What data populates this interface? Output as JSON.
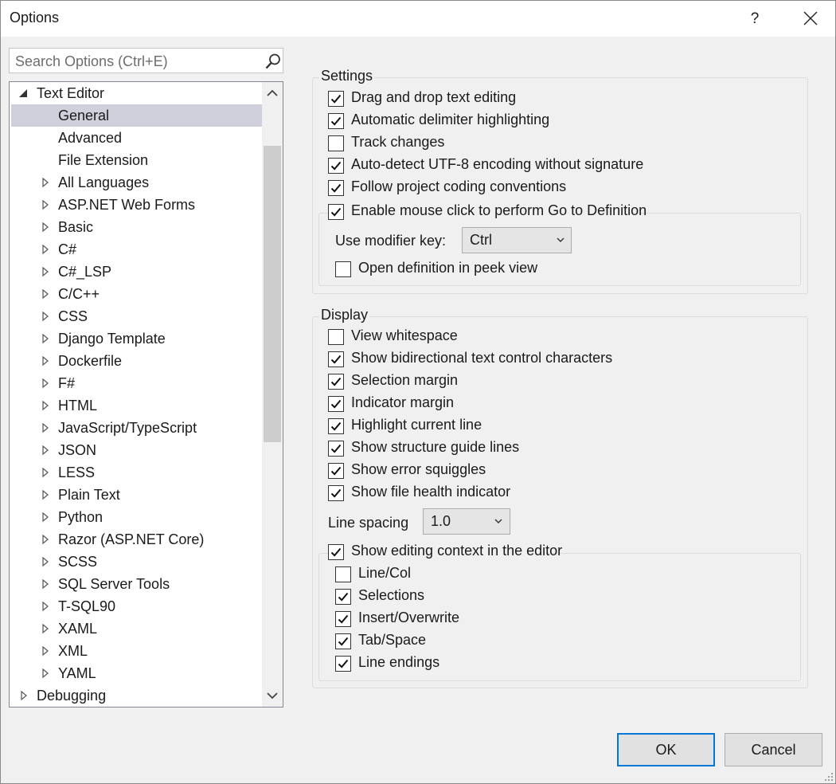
{
  "window": {
    "title": "Options",
    "help_label": "?"
  },
  "search": {
    "placeholder": "Search Options (Ctrl+E)"
  },
  "tree": [
    {
      "label": "Text Editor",
      "level": 0,
      "expanded": true
    },
    {
      "label": "General",
      "level": 1,
      "selected": true
    },
    {
      "label": "Advanced",
      "level": 1
    },
    {
      "label": "File Extension",
      "level": 1
    },
    {
      "label": "All Languages",
      "level": 1,
      "collapsed": true
    },
    {
      "label": "ASP.NET Web Forms",
      "level": 1,
      "collapsed": true
    },
    {
      "label": "Basic",
      "level": 1,
      "collapsed": true
    },
    {
      "label": "C#",
      "level": 1,
      "collapsed": true
    },
    {
      "label": "C#_LSP",
      "level": 1,
      "collapsed": true
    },
    {
      "label": "C/C++",
      "level": 1,
      "collapsed": true
    },
    {
      "label": "CSS",
      "level": 1,
      "collapsed": true
    },
    {
      "label": "Django Template",
      "level": 1,
      "collapsed": true
    },
    {
      "label": "Dockerfile",
      "level": 1,
      "collapsed": true
    },
    {
      "label": "F#",
      "level": 1,
      "collapsed": true
    },
    {
      "label": "HTML",
      "level": 1,
      "collapsed": true
    },
    {
      "label": "JavaScript/TypeScript",
      "level": 1,
      "collapsed": true
    },
    {
      "label": "JSON",
      "level": 1,
      "collapsed": true
    },
    {
      "label": "LESS",
      "level": 1,
      "collapsed": true
    },
    {
      "label": "Plain Text",
      "level": 1,
      "collapsed": true
    },
    {
      "label": "Python",
      "level": 1,
      "collapsed": true
    },
    {
      "label": "Razor (ASP.NET Core)",
      "level": 1,
      "collapsed": true
    },
    {
      "label": "SCSS",
      "level": 1,
      "collapsed": true
    },
    {
      "label": "SQL Server Tools",
      "level": 1,
      "collapsed": true
    },
    {
      "label": "T-SQL90",
      "level": 1,
      "collapsed": true
    },
    {
      "label": "XAML",
      "level": 1,
      "collapsed": true
    },
    {
      "label": "XML",
      "level": 1,
      "collapsed": true
    },
    {
      "label": "YAML",
      "level": 1,
      "collapsed": true
    },
    {
      "label": "Debugging",
      "level": 0,
      "collapsed": true
    }
  ],
  "settings": {
    "title": "Settings",
    "items": [
      {
        "label": "Drag and drop text editing",
        "checked": true
      },
      {
        "label": "Automatic delimiter highlighting",
        "checked": true
      },
      {
        "label": "Track changes",
        "checked": false
      },
      {
        "label": "Auto-detect UTF-8 encoding without signature",
        "checked": true
      },
      {
        "label": "Follow project coding conventions",
        "checked": true
      }
    ],
    "goto_definition": {
      "label": "Enable mouse click to perform Go to Definition",
      "checked": true,
      "modifier_label": "Use modifier key:",
      "modifier_value": "Ctrl",
      "peek": {
        "label": "Open definition in peek view",
        "checked": false
      }
    }
  },
  "display": {
    "title": "Display",
    "items": [
      {
        "label": "View whitespace",
        "checked": false
      },
      {
        "label": "Show bidirectional text control characters",
        "checked": true
      },
      {
        "label": "Selection margin",
        "checked": true
      },
      {
        "label": "Indicator margin",
        "checked": true
      },
      {
        "label": "Highlight current line",
        "checked": true
      },
      {
        "label": "Show structure guide lines",
        "checked": true
      },
      {
        "label": "Show error squiggles",
        "checked": true
      },
      {
        "label": "Show file health indicator",
        "checked": true
      }
    ],
    "line_spacing_label": "Line spacing",
    "line_spacing_value": "1.0",
    "editing_context": {
      "label": "Show editing context in the editor",
      "checked": true,
      "items": [
        {
          "label": "Line/Col",
          "checked": false
        },
        {
          "label": "Selections",
          "checked": true
        },
        {
          "label": "Insert/Overwrite",
          "checked": true
        },
        {
          "label": "Tab/Space",
          "checked": true
        },
        {
          "label": "Line endings",
          "checked": true
        }
      ]
    }
  },
  "buttons": {
    "ok": "OK",
    "cancel": "Cancel"
  }
}
